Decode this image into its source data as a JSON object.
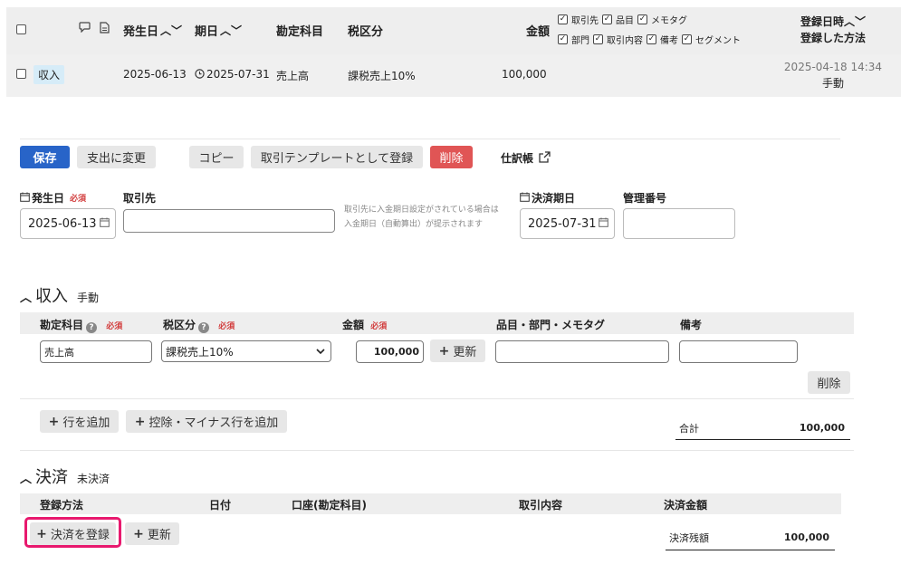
{
  "list_header": {
    "col_issue_date": "発生日",
    "col_due_date": "期日",
    "col_account": "勘定科目",
    "col_tax": "税区分",
    "col_amount": "金額",
    "col_registered": "登録日時",
    "col_method": "登録した方法",
    "toggles": [
      "取引先",
      "品目",
      "メモタグ",
      "部門",
      "取引内容",
      "備考",
      "セグメント"
    ]
  },
  "list_row": {
    "type_badge": "収入",
    "issue_date": "2025-06-13",
    "due_date": "2025-07-31",
    "account": "売上高",
    "tax": "課税売上10%",
    "amount": "100,000",
    "registered_at": "2025-04-18 14:34",
    "method": "手動"
  },
  "toolbar": {
    "save": "保存",
    "change_to_expense": "支出に変更",
    "copy": "コピー",
    "register_template": "取引テンプレートとして登録",
    "delete": "削除",
    "journal": "仕訳帳"
  },
  "form": {
    "issue_date_label": "発生日",
    "required": "必須",
    "issue_date_value": "2025-06-13",
    "partner_label": "取引先",
    "partner_value": "",
    "partner_note_1": "取引先に入金期日設定がされている場合は",
    "partner_note_2": "入金期日（自動算出）が提示されます",
    "due_date_label": "決済期日",
    "due_date_value": "2025-07-31",
    "mgmt_no_label": "管理番号",
    "mgmt_no_value": ""
  },
  "income": {
    "title": "収入",
    "mode": "手動",
    "col_account": "勘定科目",
    "col_tax": "税区分",
    "col_amount": "金額",
    "col_items": "品目・部門・メモタグ",
    "col_note": "備考",
    "row_account": "売上高",
    "row_tax": "課税売上10%",
    "row_amount": "100,000",
    "update": "更新",
    "row_delete": "削除",
    "add_row": "行を追加",
    "add_minus_row": "控除・マイナス行を追加",
    "total_label": "合計",
    "total_value": "100,000"
  },
  "payment": {
    "title": "決済",
    "status": "未決済",
    "col_method": "登録方法",
    "col_date": "日付",
    "col_account": "口座(勘定科目)",
    "col_desc": "取引内容",
    "col_amount": "決済金額",
    "register": "決済を登録",
    "update": "更新",
    "balance_label": "決済残額",
    "balance_value": "100,000"
  },
  "colors": {
    "primary": "#2864c8",
    "danger": "#e05555",
    "highlight": "#e8196e",
    "badge_bg": "#d6ecf8"
  }
}
